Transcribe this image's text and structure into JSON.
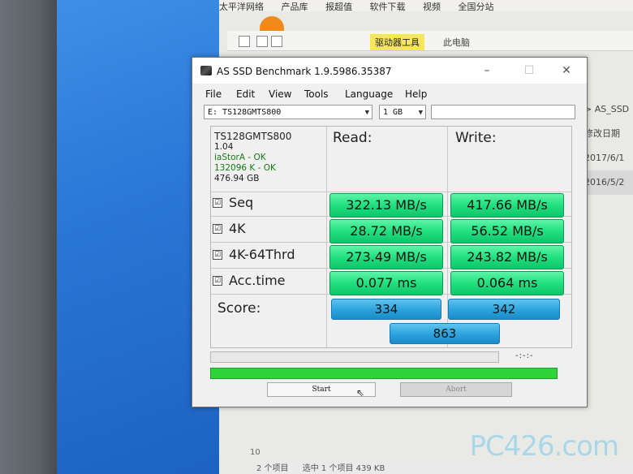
{
  "explorer": {
    "top_items": [
      "太平洋网络",
      "产品库",
      "报超值",
      "软件下载",
      "视频",
      "全国分站"
    ],
    "ribbon_tool_label": "驱动器工具",
    "ribbon_pc_label": "此电脑",
    "breadcrumb_tail": "> AS_SSD",
    "column_header": "修改日期",
    "dates": [
      "2017/6/1",
      "2016/5/2"
    ],
    "footer_items": [
      "2 个项目",
      "选中 1 个项目 439 KB"
    ],
    "side_number": "10"
  },
  "watermark": "PC426.com",
  "window": {
    "title": "AS SSD Benchmark 1.9.5986.35387",
    "controls": {
      "minimize": "–",
      "maximize": "☐",
      "close": "✕"
    }
  },
  "menu": [
    "File",
    "Edit",
    "View",
    "Tools",
    "Language",
    "Help"
  ],
  "drive_select": "E: TS128GMTS800",
  "size_select": "1 GB",
  "drive_info": {
    "model": "TS128GMTS800",
    "firmware": "1.04",
    "driver": "iaStorA - OK",
    "alignment": "132096 K - OK",
    "capacity": "476.94 GB"
  },
  "headers": {
    "read": "Read:",
    "write": "Write:"
  },
  "rows": [
    {
      "label": "Seq",
      "read": "322.13 MB/s",
      "write": "417.66 MB/s"
    },
    {
      "label": "4K",
      "read": "28.72 MB/s",
      "write": "56.52 MB/s"
    },
    {
      "label": "4K-64Thrd",
      "read": "273.49 MB/s",
      "write": "243.82 MB/s"
    },
    {
      "label": "Acc.time",
      "read": "0.077 ms",
      "write": "0.064 ms"
    }
  ],
  "score": {
    "label": "Score:",
    "read": "334",
    "write": "342",
    "total": "863"
  },
  "time_readout": "-:-:-",
  "progress": 1.0,
  "buttons": {
    "start": "Start",
    "abort": "Abort"
  },
  "checkbox_glyph": "☑",
  "colors": {
    "result_green": "#20e07f",
    "score_blue": "#2aa2dd",
    "progress_green": "#2fd33a"
  }
}
